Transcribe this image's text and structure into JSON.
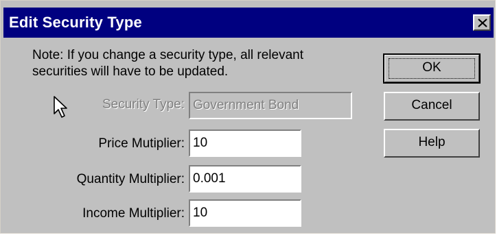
{
  "dialog": {
    "title": "Edit Security Type",
    "note": "Note: If you change a security type, all relevant securities will have to be updated."
  },
  "fields": {
    "security_type": {
      "label": "Security Type:",
      "value": "Government Bond"
    },
    "price_multiplier": {
      "label": "Price Mutiplier:",
      "value": "10"
    },
    "quantity_multiplier": {
      "label": "Quantity Multiplier:",
      "value": "0.001"
    },
    "income_multiplier": {
      "label": "Income Multiplier:",
      "value": "10"
    }
  },
  "buttons": {
    "ok": "OK",
    "cancel": "Cancel",
    "help": "Help"
  },
  "icons": {
    "close": "close-icon",
    "cursor": "mouse-pointer-icon"
  },
  "colors": {
    "titlebar": "#000080",
    "face": "#c0c0c0"
  }
}
